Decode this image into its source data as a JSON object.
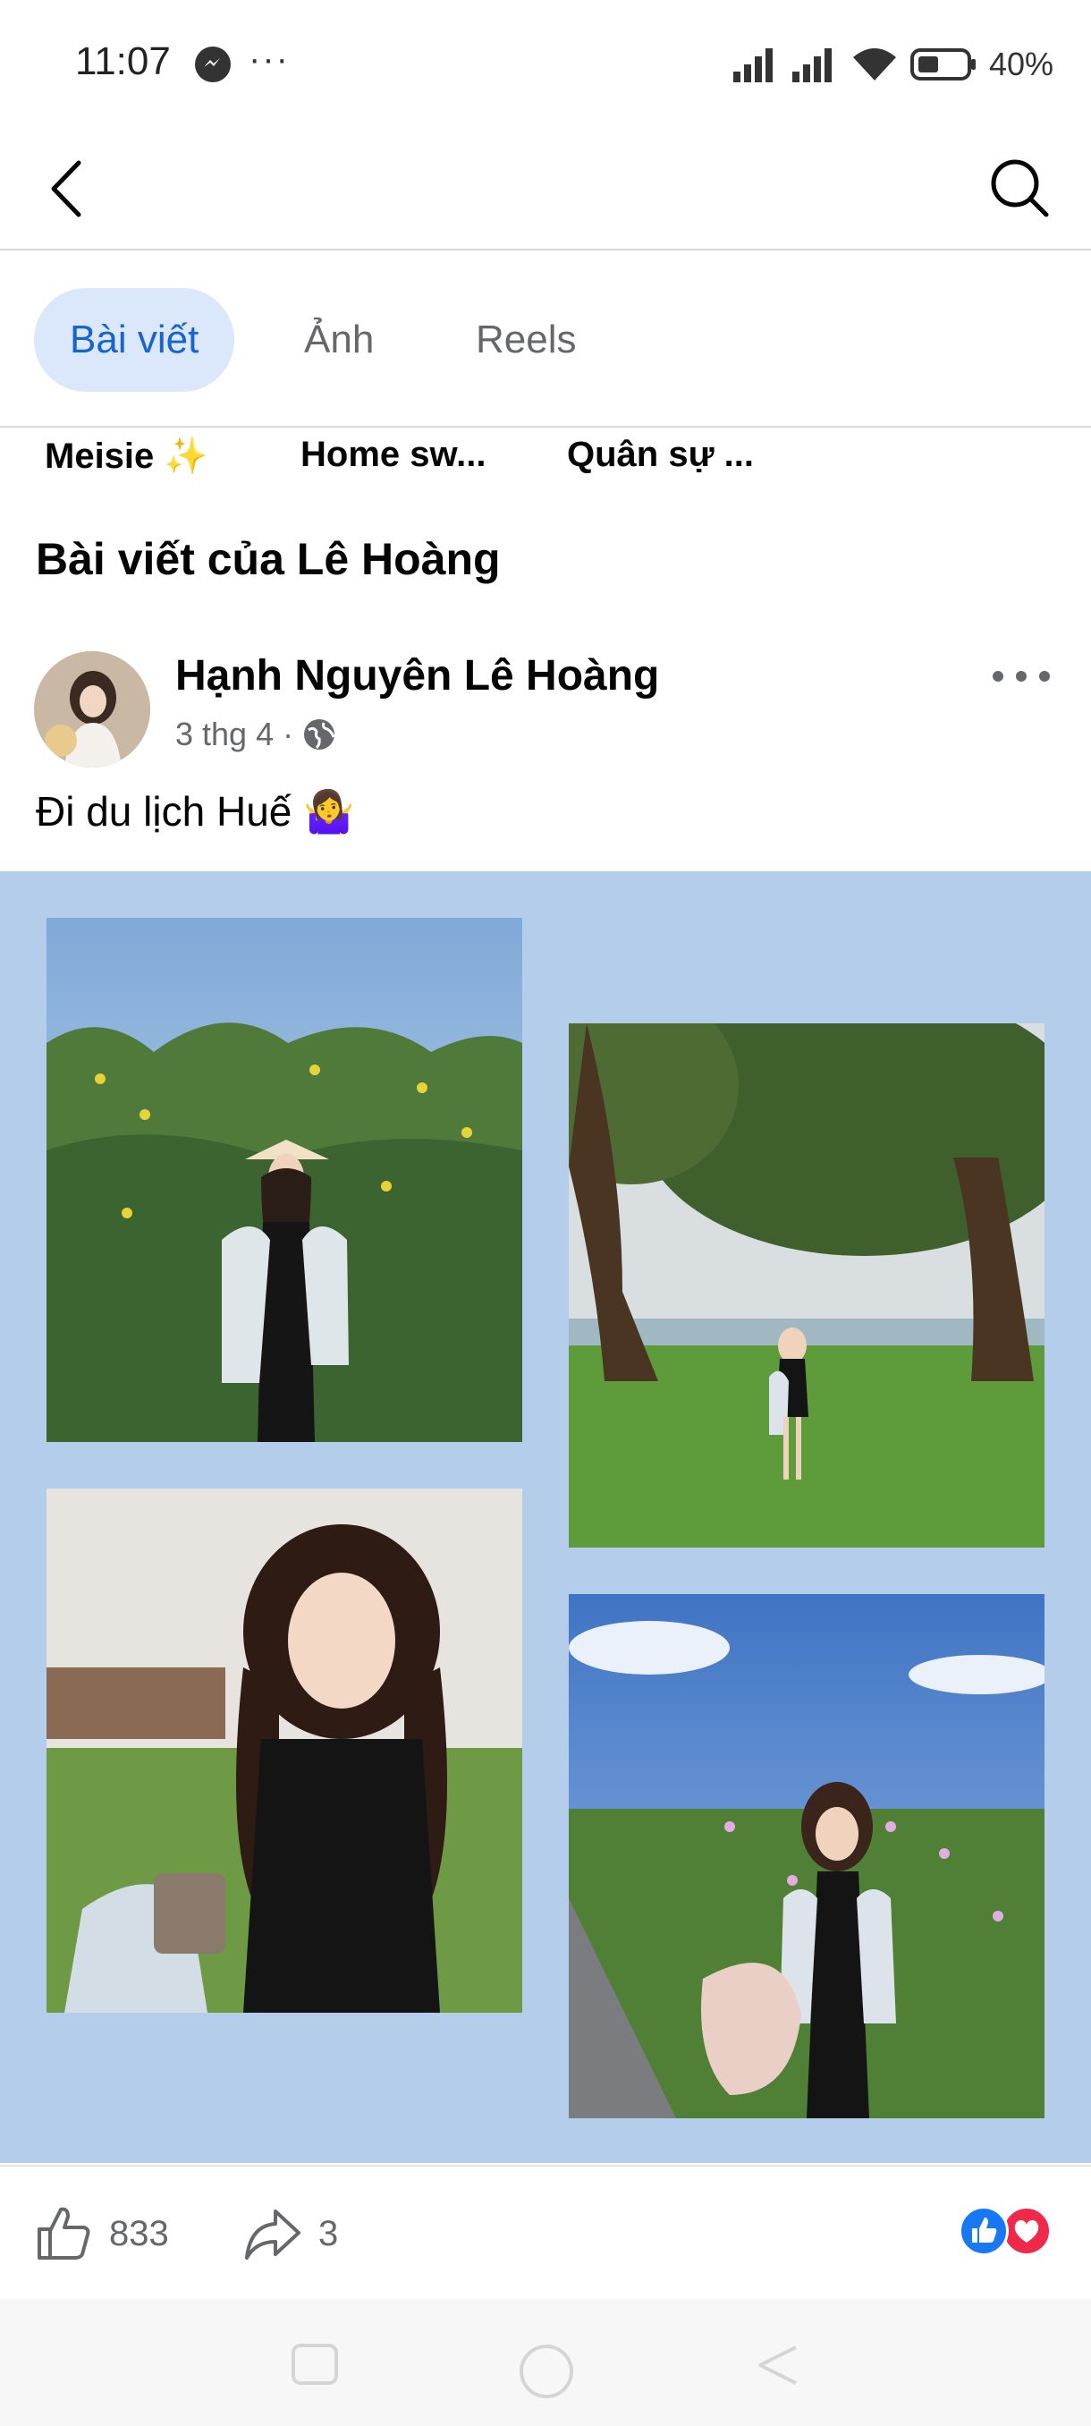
{
  "status_bar": {
    "time": "11:07",
    "dots": "···",
    "battery": "40%"
  },
  "tabs": [
    {
      "label": "Bài viết",
      "active": true
    },
    {
      "label": "Ảnh",
      "active": false
    },
    {
      "label": "Reels",
      "active": false
    }
  ],
  "chips": [
    "Meisie ✨",
    "Home sw...",
    "Quân sự ..."
  ],
  "section_title": "Bài viết của Lê Hoàng",
  "post": {
    "author": "Hạnh Nguyên Lê Hoàng",
    "date": "3 thg 4",
    "separator": "·",
    "caption": "Đi du lịch Huế 🤷‍♀️",
    "likes": "833",
    "shares": "3"
  },
  "colors": {
    "accent": "#1763cf",
    "tab_active_bg": "#dbe7fb",
    "collage_bg": "#b3cdeb",
    "like": "#1877f2",
    "love": "#f02849"
  },
  "icons": [
    "back-arrow-icon",
    "search-icon",
    "globe-icon",
    "more-icon",
    "like-icon",
    "share-icon",
    "messenger-icon",
    "signal-icon",
    "wifi-icon",
    "battery-icon"
  ]
}
